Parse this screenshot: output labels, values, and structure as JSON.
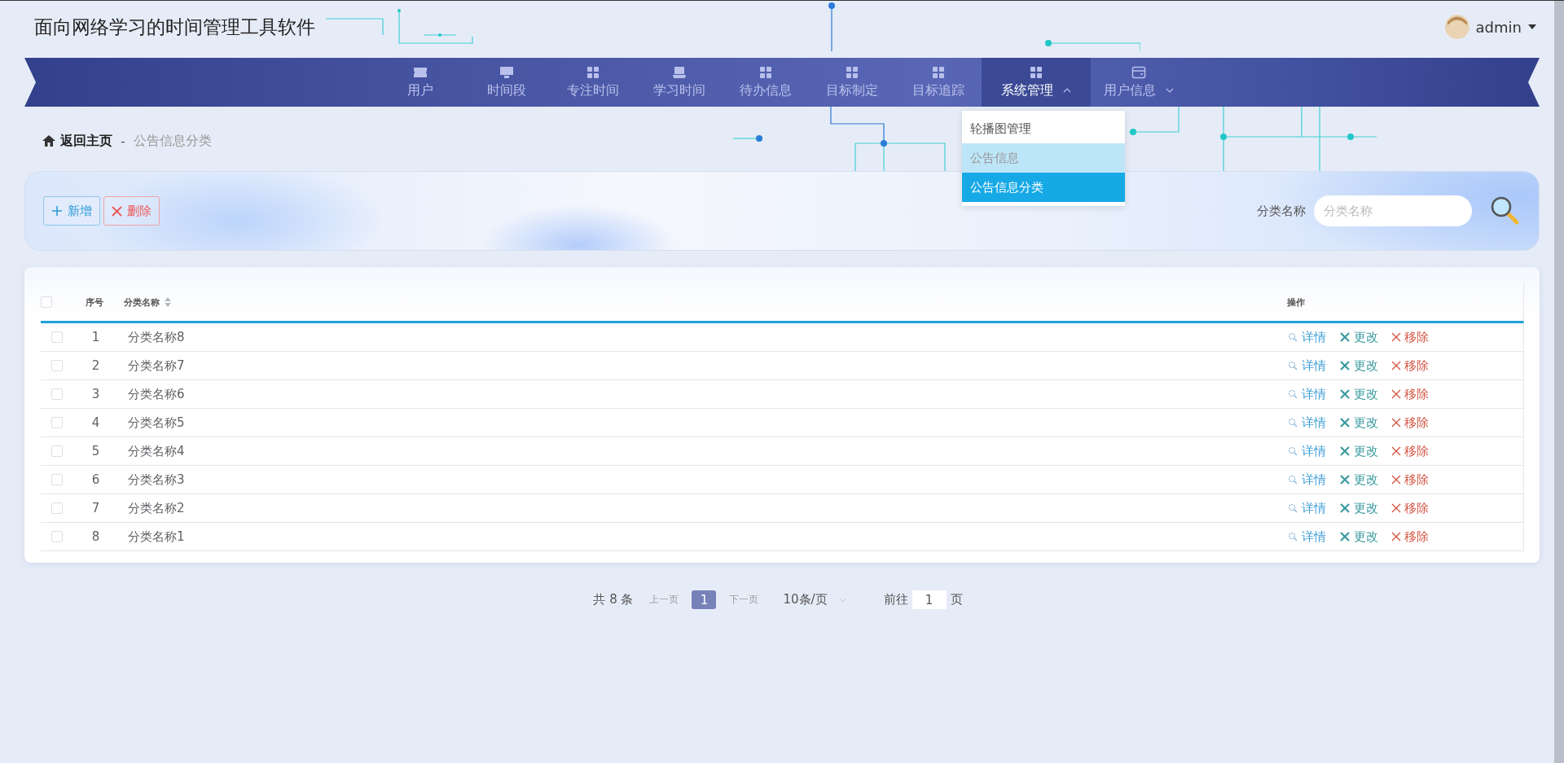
{
  "header": {
    "title": "面向网络学习的时间管理工具软件",
    "user": "admin"
  },
  "nav": [
    {
      "label": "用户",
      "kind": "ticket",
      "selected": false
    },
    {
      "label": "时间段",
      "kind": "monitor",
      "selected": false
    },
    {
      "label": "专注时间",
      "kind": "grid",
      "selected": false
    },
    {
      "label": "学习时间",
      "kind": "laptop",
      "selected": false
    },
    {
      "label": "待办信息",
      "kind": "grid",
      "selected": false
    },
    {
      "label": "目标制定",
      "kind": "grid",
      "selected": false
    },
    {
      "label": "目标追踪",
      "kind": "grid",
      "selected": false
    },
    {
      "label": "系统管理",
      "kind": "grid",
      "selected": true,
      "expanded": true,
      "submenu": [
        {
          "label": "轮播图管理",
          "selected": false,
          "hovered": false
        },
        {
          "label": "公告信息",
          "selected": false,
          "hovered": true
        },
        {
          "label": "公告信息分类",
          "selected": true,
          "hovered": false
        }
      ]
    },
    {
      "label": "用户信息",
      "kind": "card",
      "selected": false,
      "expanded": false
    }
  ],
  "breadcrumb": {
    "home": "返回主页",
    "separator": "-",
    "current": "公告信息分类"
  },
  "toolbar": {
    "add": "新增",
    "delete": "删除",
    "search_label": "分类名称",
    "search_placeholder": "分类名称"
  },
  "table": {
    "all_checked": false,
    "columns": [
      "序号",
      "分类名称",
      "操作"
    ],
    "rows": [
      {
        "index": "1",
        "name": "分类名称8",
        "checked": false,
        "actions": [
          "详情",
          "更改",
          "移除"
        ]
      },
      {
        "index": "2",
        "name": "分类名称7",
        "checked": false,
        "actions": [
          "详情",
          "更改",
          "移除"
        ]
      },
      {
        "index": "3",
        "name": "分类名称6",
        "checked": false,
        "actions": [
          "详情",
          "更改",
          "移除"
        ]
      },
      {
        "index": "4",
        "name": "分类名称5",
        "checked": false,
        "actions": [
          "详情",
          "更改",
          "移除"
        ]
      },
      {
        "index": "5",
        "name": "分类名称4",
        "checked": false,
        "actions": [
          "详情",
          "更改",
          "移除"
        ]
      },
      {
        "index": "6",
        "name": "分类名称3",
        "checked": false,
        "actions": [
          "详情",
          "更改",
          "移除"
        ]
      },
      {
        "index": "7",
        "name": "分类名称2",
        "checked": false,
        "actions": [
          "详情",
          "更改",
          "移除"
        ]
      },
      {
        "index": "8",
        "name": "分类名称1",
        "checked": false,
        "actions": [
          "详情",
          "更改",
          "移除"
        ]
      }
    ]
  },
  "pagination": {
    "total": "共 8 条",
    "prev": "上一页",
    "pages": [
      {
        "label": "1",
        "selected": true
      }
    ],
    "next": "下一页",
    "page_size": "10条/页",
    "goto": "前往",
    "goto_value": "1",
    "page_unit": "页"
  }
}
